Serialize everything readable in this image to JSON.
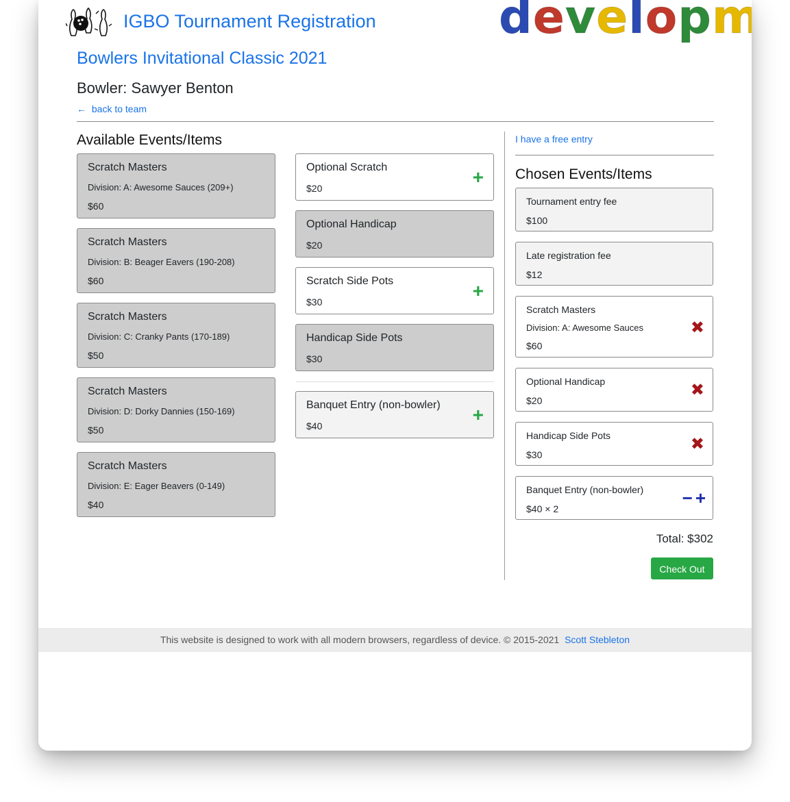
{
  "header": {
    "app_title": "IGBO Tournament Registration",
    "banner": "development",
    "banner_colors": [
      "#2b4bb3",
      "#c0392b",
      "#2e8b3a",
      "#e6b800",
      "#2b4bb3",
      "#c0392b",
      "#2e8b3a",
      "#e6b800",
      "#2b4bb3",
      "#c0392b",
      "#2e8b3a"
    ]
  },
  "page": {
    "tournament": "Bowlers Invitational Classic 2021",
    "bowler": "Bowler: Sawyer Benton",
    "back_link": "back to team",
    "back_icon": "←"
  },
  "available": {
    "header": "Available Events/Items",
    "left_items": [
      {
        "name": "Scratch Masters",
        "division": "Division: A: Awesome Sauces (209+)",
        "price": "$60"
      },
      {
        "name": "Scratch Masters",
        "division": "Division: B: Beager Eavers (190-208)",
        "price": "$60"
      },
      {
        "name": "Scratch Masters",
        "division": "Division: C: Cranky Pants (170-189)",
        "price": "$50"
      },
      {
        "name": "Scratch Masters",
        "division": "Division: D: Dorky Dannies (150-169)",
        "price": "$50"
      },
      {
        "name": "Scratch Masters",
        "division": "Division: E: Eager Beavers (0-149)",
        "price": "$40"
      }
    ],
    "middle_items": [
      {
        "name": "Optional Scratch",
        "price": "$20"
      },
      {
        "name": "Optional Handicap",
        "price": "$20"
      },
      {
        "name": "Scratch Side Pots",
        "price": "$30"
      },
      {
        "name": "Handicap Side Pots",
        "price": "$30"
      },
      {
        "name": "Banquet Entry (non-bowler)",
        "price": "$40"
      }
    ],
    "add_icon": "+"
  },
  "chosen": {
    "free_entry_link": "I have a free entry",
    "header": "Chosen Events/Items",
    "items": [
      {
        "name": "Tournament entry fee",
        "price": "$100"
      },
      {
        "name": "Late registration fee",
        "price": "$12"
      },
      {
        "name": "Scratch Masters",
        "division": "Division: A: Awesome Sauces",
        "price": "$60"
      },
      {
        "name": "Optional Handicap",
        "price": "$20"
      },
      {
        "name": "Handicap Side Pots",
        "price": "$30"
      },
      {
        "name": "Banquet Entry (non-bowler)",
        "price": "$40 × 2"
      }
    ],
    "remove_icon": "✖",
    "minus_icon": "−",
    "plus_icon": "+",
    "total": "Total: $302",
    "checkout_label": "Check Out"
  },
  "footer": {
    "text": "This website is designed to work with all modern browsers, regardless of device. © 2015-2021",
    "link": "Scott Stebleton"
  }
}
